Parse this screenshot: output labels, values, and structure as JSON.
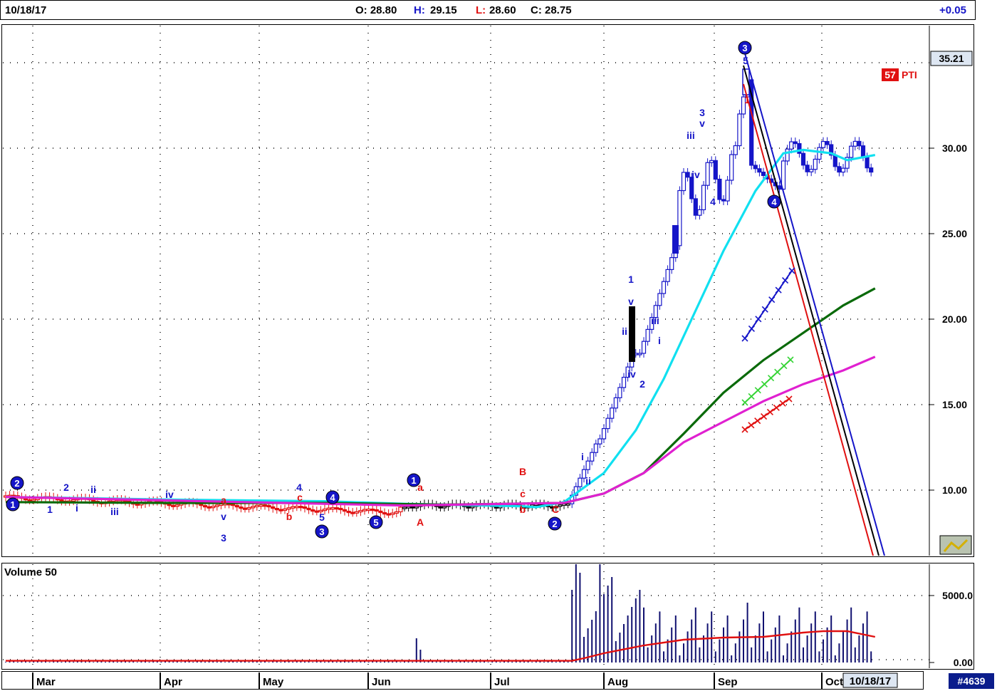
{
  "header": {
    "date": "10/18/17",
    "open": "O: 28.80",
    "high_label": "H:",
    "high_value": "29.15",
    "low_label": "L:",
    "low_value": "28.60",
    "close": "C: 28.75",
    "change": "+0.05"
  },
  "colors": {
    "up": "#1515c8",
    "down_black": "#000000",
    "down_red": "#e01010",
    "cyan": "#10e0f0",
    "green": "#0a6a0a",
    "magenta": "#e020d0",
    "volume_bar": "#101070",
    "volume_avg": "#e01010",
    "badge": "#0b1d8c"
  },
  "chart_data": {
    "type": "candlestick",
    "x_months": [
      "Mar",
      "Apr",
      "May",
      "Jun",
      "Jul",
      "Aug",
      "Sep",
      "Oct"
    ],
    "x_current": "10/18/17",
    "y_ticks": [
      "10.00",
      "15.00",
      "20.00",
      "25.00",
      "30.00"
    ],
    "y_range": [
      6.0,
      37.0
    ],
    "y_high_label": "35.21",
    "indicator_badge": "57",
    "indicator_name": "PTI",
    "series": [
      {
        "color": "cyan",
        "points": [
          [
            0,
            9.6
          ],
          [
            40,
            9.45
          ],
          [
            80,
            9.35
          ],
          [
            100,
            9.2
          ],
          [
            120,
            9.1
          ],
          [
            130,
            9.05
          ],
          [
            133,
            9.0
          ],
          [
            140,
            9.3
          ],
          [
            150,
            11.0
          ],
          [
            158,
            13.5
          ],
          [
            165,
            16.5
          ],
          [
            172,
            20.0
          ],
          [
            180,
            24.0
          ],
          [
            188,
            27.5
          ],
          [
            195,
            29.7
          ],
          [
            200,
            29.9
          ],
          [
            207,
            29.7
          ],
          [
            211,
            29.3
          ],
          [
            218,
            29.6
          ]
        ]
      },
      {
        "color": "green",
        "points": [
          [
            0,
            9.3
          ],
          [
            40,
            9.25
          ],
          [
            80,
            9.25
          ],
          [
            110,
            9.15
          ],
          [
            140,
            9.25
          ],
          [
            150,
            9.8
          ],
          [
            160,
            11.0
          ],
          [
            170,
            13.3
          ],
          [
            180,
            15.7
          ],
          [
            190,
            17.6
          ],
          [
            200,
            19.2
          ],
          [
            210,
            20.8
          ],
          [
            218,
            21.8
          ]
        ]
      },
      {
        "color": "magenta",
        "points": [
          [
            0,
            9.6
          ],
          [
            60,
            9.3
          ],
          [
            100,
            9.1
          ],
          [
            140,
            9.25
          ],
          [
            150,
            9.8
          ],
          [
            160,
            11.0
          ],
          [
            170,
            12.8
          ],
          [
            180,
            14.0
          ],
          [
            190,
            15.2
          ],
          [
            200,
            16.2
          ],
          [
            210,
            17.0
          ],
          [
            218,
            17.8
          ]
        ]
      }
    ],
    "volume": {
      "label": "Volume 50",
      "y_ticks": [
        "5000.0",
        "0.00"
      ],
      "y_max": 6900,
      "avg_line": [
        [
          0,
          120
        ],
        [
          142,
          120
        ],
        [
          145,
          300
        ],
        [
          150,
          650
        ],
        [
          160,
          1200
        ],
        [
          170,
          1600
        ],
        [
          180,
          1750
        ],
        [
          190,
          1800
        ],
        [
          200,
          2100
        ],
        [
          205,
          2200
        ],
        [
          211,
          2200
        ],
        [
          218,
          1800
        ]
      ]
    },
    "footer_badge": "#4639"
  }
}
